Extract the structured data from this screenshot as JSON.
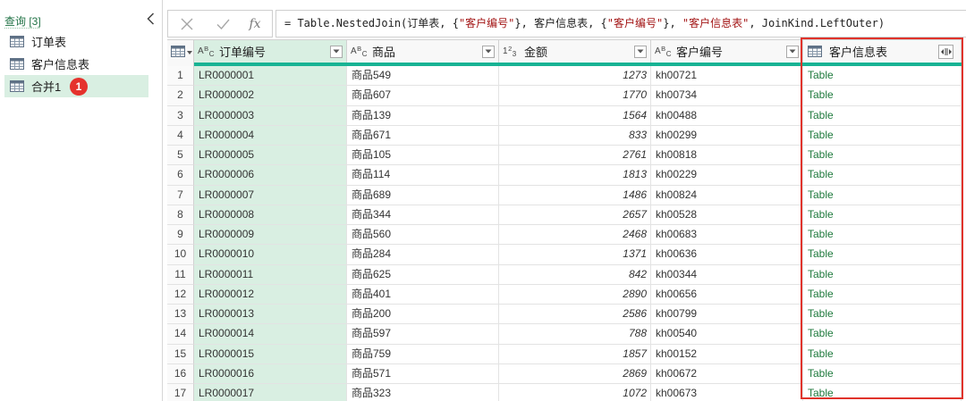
{
  "colors": {
    "accent": "#217346",
    "quality_bar": "#18b394",
    "selected_column": "#d9efe2",
    "highlight_box": "#e0332b",
    "badge": "#e5322d",
    "string_literal": "#a31515",
    "table_value": "#1f7a3d"
  },
  "queries_pane": {
    "title": "查询 [3]",
    "collapse_icon": "chevron-left-icon",
    "items": [
      {
        "label": "订单表",
        "icon": "table-icon",
        "selected": false
      },
      {
        "label": "客户信息表",
        "icon": "table-icon",
        "selected": false
      },
      {
        "label": "合并1",
        "icon": "table-icon",
        "selected": true,
        "badge": "1"
      }
    ]
  },
  "formula_bar": {
    "cancel_icon": "close-icon",
    "commit_icon": "check-icon",
    "fx_label": "fx",
    "formula_parts": [
      {
        "text": "= Table.NestedJoin(订单表, {",
        "is_string": false
      },
      {
        "text": "\"客户编号\"",
        "is_string": true
      },
      {
        "text": "}, 客户信息表, {",
        "is_string": false
      },
      {
        "text": "\"客户编号\"",
        "is_string": true
      },
      {
        "text": "}, ",
        "is_string": false
      },
      {
        "text": "\"客户信息表\"",
        "is_string": true
      },
      {
        "text": ", JoinKind.LeftOuter)",
        "is_string": false
      }
    ]
  },
  "table": {
    "corner_icon": "table-icon",
    "dropdown_icon": "chevron-down-icon",
    "columns": [
      {
        "label": "订单编号",
        "type_glyph": {
          "base": "A",
          "sup": "B",
          "sub": "C"
        },
        "selected": true
      },
      {
        "label": "商品",
        "type_glyph": {
          "base": "A",
          "sup": "B",
          "sub": "C"
        },
        "selected": false
      },
      {
        "label": "金额",
        "type_glyph": {
          "base": "1",
          "sup": "2",
          "sub": "3"
        },
        "selected": false
      },
      {
        "label": "客户编号",
        "type_glyph": {
          "base": "A",
          "sup": "B",
          "sub": "C"
        },
        "selected": false
      },
      {
        "label": "客户信息表",
        "type_icon": "table-icon",
        "action_icon": "expand-column-icon",
        "selected": false
      }
    ],
    "rows": [
      [
        1,
        "LR0000001",
        "商品549",
        1273,
        "kh00721",
        "Table"
      ],
      [
        2,
        "LR0000002",
        "商品607",
        1770,
        "kh00734",
        "Table"
      ],
      [
        3,
        "LR0000003",
        "商品139",
        1564,
        "kh00488",
        "Table"
      ],
      [
        4,
        "LR0000004",
        "商品671",
        833,
        "kh00299",
        "Table"
      ],
      [
        5,
        "LR0000005",
        "商品105",
        2761,
        "kh00818",
        "Table"
      ],
      [
        6,
        "LR0000006",
        "商品114",
        1813,
        "kh00229",
        "Table"
      ],
      [
        7,
        "LR0000007",
        "商品689",
        1486,
        "kh00824",
        "Table"
      ],
      [
        8,
        "LR0000008",
        "商品344",
        2657,
        "kh00528",
        "Table"
      ],
      [
        9,
        "LR0000009",
        "商品560",
        2468,
        "kh00683",
        "Table"
      ],
      [
        10,
        "LR0000010",
        "商品284",
        1371,
        "kh00636",
        "Table"
      ],
      [
        11,
        "LR0000011",
        "商品625",
        842,
        "kh00344",
        "Table"
      ],
      [
        12,
        "LR0000012",
        "商品401",
        2890,
        "kh00656",
        "Table"
      ],
      [
        13,
        "LR0000013",
        "商品200",
        2586,
        "kh00799",
        "Table"
      ],
      [
        14,
        "LR0000014",
        "商品597",
        788,
        "kh00540",
        "Table"
      ],
      [
        15,
        "LR0000015",
        "商品759",
        1857,
        "kh00152",
        "Table"
      ],
      [
        16,
        "LR0000016",
        "商品571",
        2869,
        "kh00672",
        "Table"
      ],
      [
        17,
        "LR0000017",
        "商品323",
        1072,
        "kh00673",
        "Table"
      ]
    ]
  }
}
